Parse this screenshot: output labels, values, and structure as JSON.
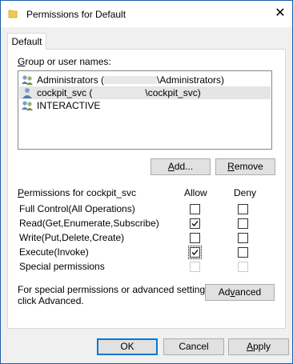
{
  "window": {
    "title": "Permissions for Default",
    "close_glyph": "✕"
  },
  "tab": {
    "label": "Default"
  },
  "groups": {
    "label": "Group or user names:",
    "items": [
      {
        "name": "Administrators (",
        "suffix": "\\Administrators)",
        "icon": "group-users-icon"
      },
      {
        "name": "cockpit_svc (",
        "suffix": "\\cockpit_svc)",
        "icon": "user-icon"
      },
      {
        "name": "INTERACTIVE",
        "suffix": "",
        "icon": "group-users-icon"
      }
    ],
    "selected_index": 1
  },
  "buttons": {
    "add": "Add...",
    "remove": "Remove",
    "advanced": "Advanced",
    "ok": "OK",
    "cancel": "Cancel",
    "apply": "Apply"
  },
  "permissions": {
    "title": "Permissions for cockpit_svc",
    "allow_header": "Allow",
    "deny_header": "Deny",
    "rows": [
      {
        "label": "Full Control(All Operations)",
        "allow": false,
        "deny": false,
        "enabled": true
      },
      {
        "label": "Read(Get,Enumerate,Subscribe)",
        "allow": true,
        "deny": false,
        "enabled": true
      },
      {
        "label": "Write(Put,Delete,Create)",
        "allow": false,
        "deny": false,
        "enabled": true
      },
      {
        "label": "Execute(Invoke)",
        "allow": true,
        "deny": false,
        "enabled": true
      },
      {
        "label": "Special permissions",
        "allow": false,
        "deny": false,
        "enabled": false
      }
    ]
  },
  "advanced_note": {
    "line1": "For special permissions or advanced settings,",
    "line2": "click Advanced."
  },
  "colors": {
    "accent": "#0078d7",
    "border": "#adadad",
    "selection": "#e5e5e5"
  }
}
